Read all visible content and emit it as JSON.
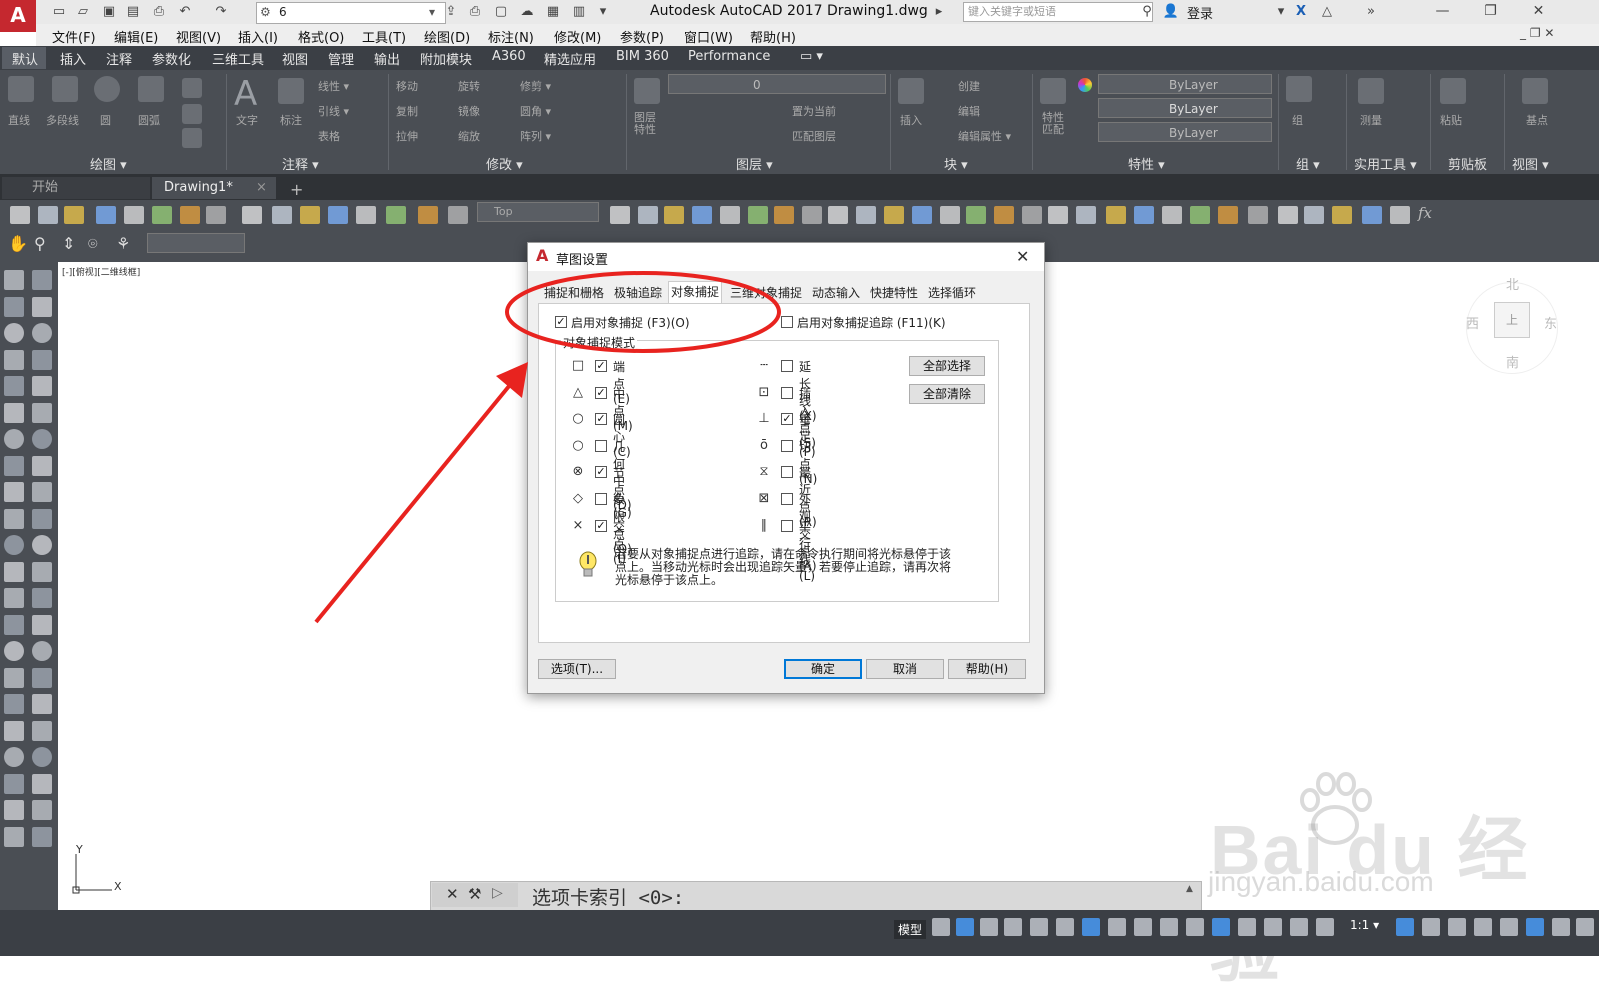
{
  "titlebar": {
    "app_logo": "A",
    "workspace": "6",
    "title": "Autodesk AutoCAD 2017    Drawing1.dwg",
    "search_placeholder": "键入关键字或短语",
    "login": "登录"
  },
  "menu": [
    "文件(F)",
    "编辑(E)",
    "视图(V)",
    "插入(I)",
    "格式(O)",
    "工具(T)",
    "绘图(D)",
    "标注(N)",
    "修改(M)",
    "参数(P)",
    "窗口(W)",
    "帮助(H)"
  ],
  "ribbon_tabs": [
    "默认",
    "插入",
    "注释",
    "参数化",
    "三维工具",
    "视图",
    "管理",
    "输出",
    "附加模块",
    "A360",
    "精选应用",
    "BIM 360",
    "Performance"
  ],
  "ribbon_panels": {
    "draw": {
      "label": "绘图 ▾",
      "tools": [
        "直线",
        "多段线",
        "圆",
        "圆弧"
      ]
    },
    "annotation": {
      "label": "注释 ▾",
      "tools": [
        "文字",
        "标注",
        "线性 ▾",
        "引线 ▾",
        "表格"
      ]
    },
    "modify": {
      "label": "修改 ▾",
      "tools": [
        "移动",
        "旋转",
        "修剪 ▾",
        "复制",
        "镜像",
        "圆角 ▾",
        "拉伸",
        "缩放",
        "阵列 ▾"
      ]
    },
    "layers": {
      "label": "图层 ▾",
      "tools": [
        "图层特性",
        "置为当前",
        "匹配图层"
      ],
      "current_layer": "0"
    },
    "block": {
      "label": "块 ▾",
      "tools": [
        "插入",
        "创建",
        "编辑",
        "编辑属性 ▾"
      ]
    },
    "properties": {
      "label": "特性 ▾",
      "tools": [
        "特性匹配"
      ],
      "combos": [
        "ByLayer",
        "ByLayer",
        "ByLayer"
      ]
    },
    "groups": {
      "label": "组 ▾",
      "tools": [
        "组"
      ]
    },
    "utilities": {
      "label": "实用工具 ▾",
      "tools": [
        "测量"
      ]
    },
    "clipboard": {
      "label": "剪贴板",
      "tools": [
        "粘贴"
      ]
    },
    "view": {
      "label": "视图 ▾",
      "tools": [
        "基点"
      ]
    }
  },
  "doc_tabs": {
    "start": "开始",
    "drawing": "Drawing1*",
    "close": "×",
    "add": "+"
  },
  "toolbar": {
    "view_combo": "Top",
    "fx": "fx"
  },
  "viewport_label": "[-][俯视][二维线框]",
  "viewcube": {
    "n": "北",
    "w": "西",
    "e": "东",
    "s": "南",
    "face": "上"
  },
  "ucs": {
    "x": "X",
    "y": "Y"
  },
  "command_line": {
    "text": "选项卡索引 <0>:"
  },
  "status": {
    "model": "模型",
    "scale": "1:1 ▾"
  },
  "watermark": {
    "brand": "Bai du 经验",
    "url": "jingyan.baidu.com"
  },
  "dialog": {
    "title": "草图设置",
    "close": "✕",
    "tabs": [
      "捕捉和栅格",
      "极轴追踪",
      "对象捕捉",
      "三维对象捕捉",
      "动态输入",
      "快捷特性",
      "选择循环"
    ],
    "active_tab": 2,
    "enable_snap": {
      "label": "启用对象捕捉 (F3)(O)",
      "checked": true
    },
    "enable_tracking": {
      "label": "启用对象捕捉追踪 (F11)(K)",
      "checked": false
    },
    "mode_group_title": "对象捕捉模式",
    "left_modes": [
      {
        "symbol": "□",
        "label": "端点(E)",
        "checked": true
      },
      {
        "symbol": "△",
        "label": "中点(M)",
        "checked": true
      },
      {
        "symbol": "○",
        "label": "圆心(C)",
        "checked": true
      },
      {
        "symbol": "○",
        "label": "几何中心(G)",
        "checked": false
      },
      {
        "symbol": "⊗",
        "label": "节点(D)",
        "checked": true
      },
      {
        "symbol": "◇",
        "label": "象限点(Q)",
        "checked": false
      },
      {
        "symbol": "×",
        "label": "交点(I)",
        "checked": true
      }
    ],
    "right_modes": [
      {
        "symbol": "┄",
        "label": "延长线(X)",
        "checked": false
      },
      {
        "symbol": "⊡",
        "label": "插入点(S)",
        "checked": false
      },
      {
        "symbol": "⊥",
        "label": "垂足(P)",
        "checked": true
      },
      {
        "symbol": "ō",
        "label": "切点(N)",
        "checked": false
      },
      {
        "symbol": "⧖",
        "label": "最近点(R)",
        "checked": false
      },
      {
        "symbol": "⊠",
        "label": "外观交点(A)",
        "checked": false
      },
      {
        "symbol": "∥",
        "label": "平行线(L)",
        "checked": false
      }
    ],
    "select_all": "全部选择",
    "clear_all": "全部清除",
    "tip": "若要从对象捕捉点进行追踪，请在命令执行期间将光标悬停于该点上。当移动光标时会出现追踪矢量，若要停止追踪，请再次将光标悬停于该点上。",
    "options_button": "选项(T)...",
    "ok_button": "确定",
    "cancel_button": "取消",
    "help_button": "帮助(H)"
  },
  "colors": {
    "annotation_red": "#e8231f",
    "ribbon_bg": "#4a4e54",
    "accent_blue": "#0078d7"
  }
}
